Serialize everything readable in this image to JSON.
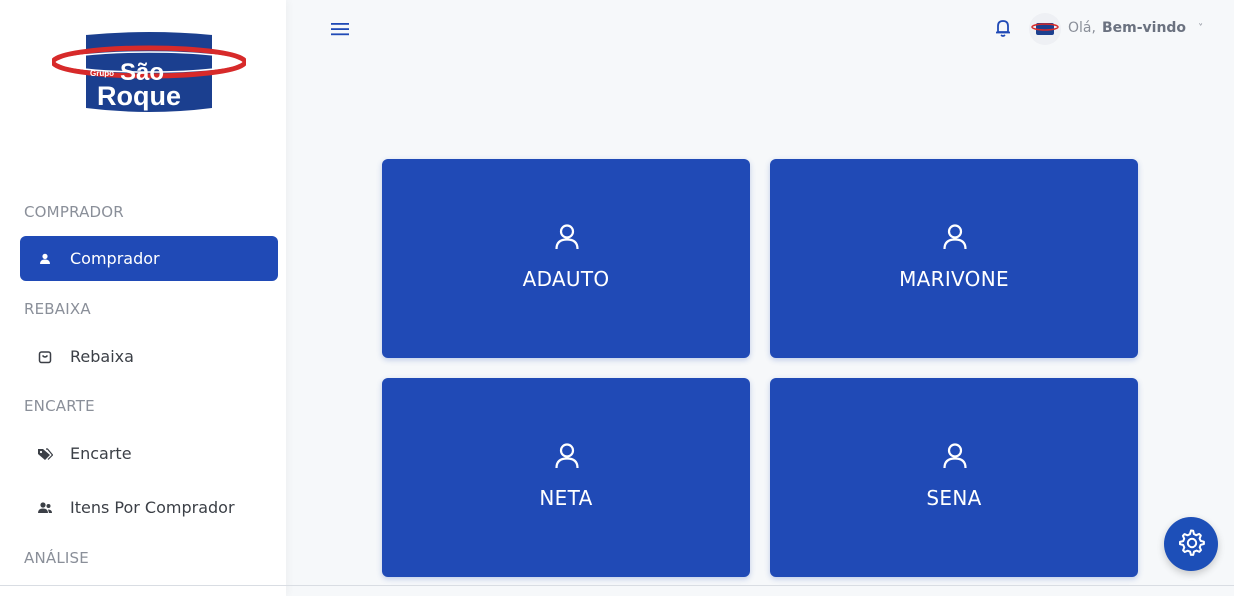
{
  "brand": {
    "small": "Grupo",
    "line1": "São",
    "line2": "Roque",
    "colors": {
      "navy": "#1b3f8f",
      "red": "#d72a2a"
    }
  },
  "sidebar": {
    "sections": [
      {
        "header": "COMPRADOR",
        "items": [
          {
            "label": "Comprador",
            "icon": "user-icon",
            "active": true
          }
        ]
      },
      {
        "header": "REBAIXA",
        "items": [
          {
            "label": "Rebaixa",
            "icon": "shopping-bag-icon",
            "active": false
          }
        ]
      },
      {
        "header": "ENCARTE",
        "items": [
          {
            "label": "Encarte",
            "icon": "tags-icon",
            "active": false
          },
          {
            "label": "Itens Por Comprador",
            "icon": "users-icon",
            "active": false
          }
        ]
      },
      {
        "header": "ANÁLISE",
        "items": []
      }
    ]
  },
  "topbar": {
    "menu_icon": "hamburger-icon",
    "bell_icon": "bell-icon",
    "greeting": "Olá,",
    "user_name": "Bem-vindo",
    "chevron": "˅"
  },
  "cards": [
    {
      "label": "ADAUTO",
      "icon": "user-icon"
    },
    {
      "label": "MARIVONE",
      "icon": "user-icon"
    },
    {
      "label": "NETA",
      "icon": "user-icon"
    },
    {
      "label": "SENA",
      "icon": "user-icon"
    }
  ],
  "fab": {
    "icon": "gear-icon"
  },
  "colors": {
    "accent": "#204ab6",
    "sidebar_bg": "#ffffff",
    "page_bg": "#f6f8fa",
    "muted_text": "#8a8f99"
  }
}
